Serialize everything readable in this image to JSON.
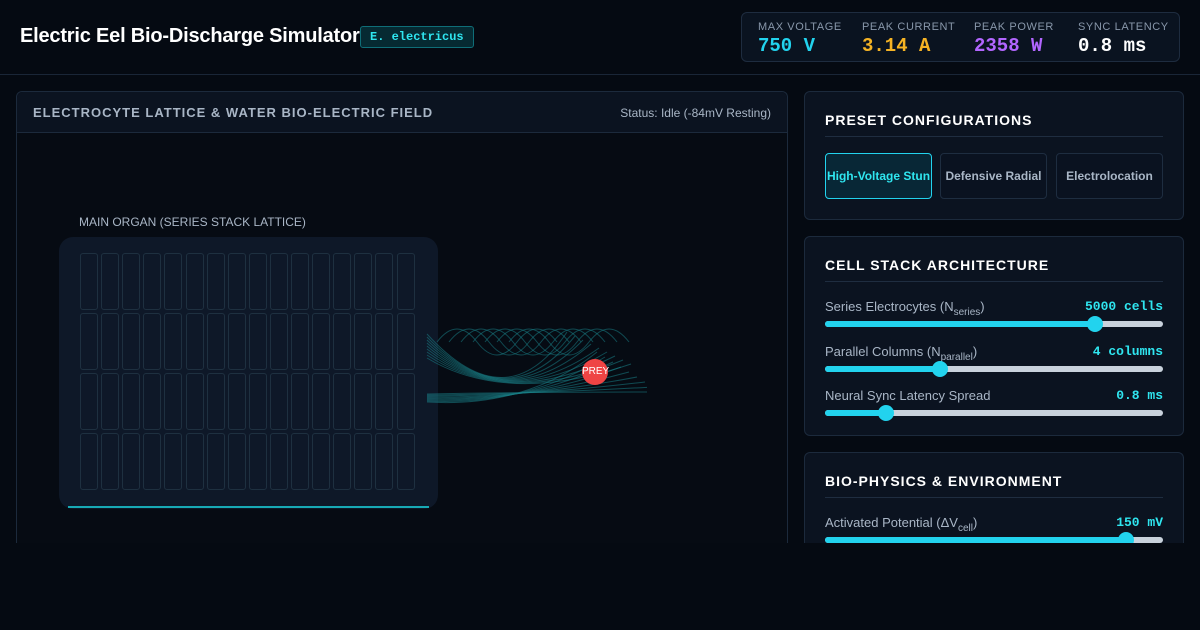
{
  "header": {
    "title": "Electric Eel Bio-Discharge Simulator",
    "badge": "E. electricus",
    "stats": [
      {
        "label": "MAX VOLTAGE",
        "value": "750 V",
        "color": "#22d3ee"
      },
      {
        "label": "PEAK CURRENT",
        "value": "3.14 A",
        "color": "#f5b324"
      },
      {
        "label": "PEAK POWER",
        "value": "2358 W",
        "color": "#b266ff"
      },
      {
        "label": "SYNC LATENCY",
        "value": "0.8 ms",
        "color": "#ffffff"
      }
    ]
  },
  "viz": {
    "title": "ELECTROCYTE LATTICE & WATER BIO-ELECTRIC FIELD",
    "status": "Status: Idle (-84mV Resting)",
    "organ_label": "MAIN ORGAN (SERIES STACK LATTICE)",
    "prey_label": "PREY",
    "lattice": {
      "rows": 4,
      "cols": 16
    }
  },
  "presets": {
    "title": "PRESET CONFIGURATIONS",
    "buttons": [
      {
        "label": "High-Voltage Stun",
        "active": true
      },
      {
        "label": "Defensive Radial",
        "active": false
      },
      {
        "label": "Electrolocation",
        "active": false
      }
    ]
  },
  "architecture": {
    "title": "CELL STACK ARCHITECTURE",
    "controls": [
      {
        "label": "Series Electrocytes (N",
        "sub": "series",
        "label_end": ")",
        "value": "5000 cells",
        "fraction": 0.8
      },
      {
        "label": "Parallel Columns (N",
        "sub": "parallel",
        "label_end": ")",
        "value": "4 columns",
        "fraction": 0.34
      },
      {
        "label": "Neural Sync Latency Spread",
        "sub": "",
        "label_end": "",
        "value": "0.8 ms",
        "fraction": 0.18
      }
    ]
  },
  "biophysics": {
    "title": "BIO-PHYSICS & ENVIRONMENT",
    "controls": [
      {
        "label": "Activated Potential (ΔV",
        "sub": "cell",
        "label_end": ")",
        "value": "150 mV",
        "fraction": 0.89
      }
    ]
  }
}
